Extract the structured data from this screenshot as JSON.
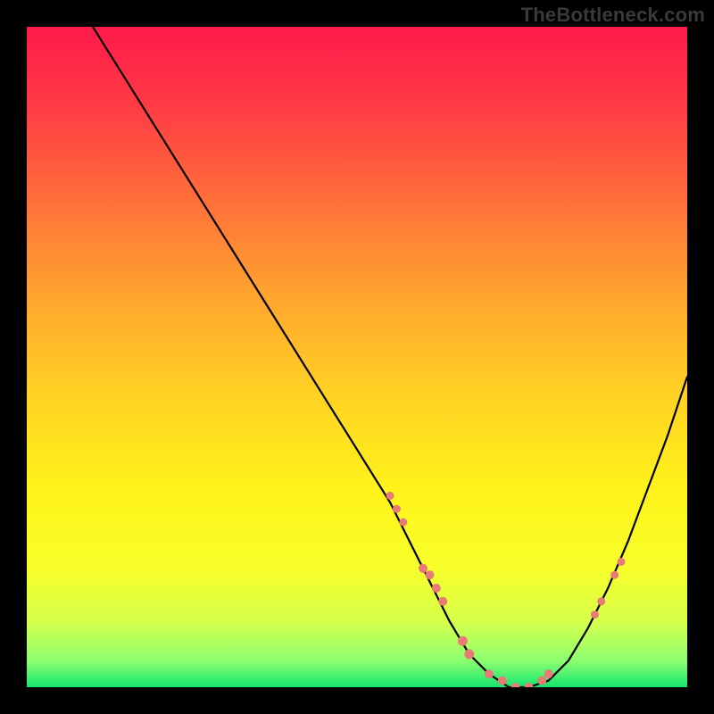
{
  "watermark": "TheBottleneck.com",
  "gradient": {
    "stops": [
      {
        "offset": 0.0,
        "color": "#ff1a4b"
      },
      {
        "offset": 0.12,
        "color": "#ff3b45"
      },
      {
        "offset": 0.25,
        "color": "#ff6a3a"
      },
      {
        "offset": 0.4,
        "color": "#ffa22f"
      },
      {
        "offset": 0.55,
        "color": "#ffd024"
      },
      {
        "offset": 0.7,
        "color": "#fff31a"
      },
      {
        "offset": 0.82,
        "color": "#f8ff2a"
      },
      {
        "offset": 0.9,
        "color": "#d6ff4a"
      },
      {
        "offset": 0.96,
        "color": "#8cff70"
      },
      {
        "offset": 1.0,
        "color": "#15e66f"
      }
    ]
  },
  "chart_data": {
    "type": "line",
    "title": "",
    "xlabel": "",
    "ylabel": "",
    "xlim": [
      0,
      100
    ],
    "ylim": [
      0,
      100
    ],
    "grid": false,
    "legend": false,
    "series": [
      {
        "name": "bottleneck-curve",
        "x": [
          10,
          15,
          20,
          25,
          30,
          35,
          40,
          45,
          50,
          55,
          58,
          61,
          64,
          67,
          70,
          73,
          76,
          79,
          82,
          85,
          88,
          91,
          94,
          97,
          100
        ],
        "y": [
          100,
          92,
          84,
          76,
          68,
          60,
          52,
          44,
          36,
          28,
          22,
          16,
          10,
          5,
          2,
          0,
          0,
          1,
          4,
          9,
          15,
          22,
          30,
          38,
          47
        ]
      }
    ],
    "markers": {
      "name": "highlight-points",
      "x": [
        55,
        56,
        57,
        60,
        61,
        62,
        63,
        66,
        67,
        70,
        72,
        74,
        76,
        78,
        79,
        86,
        87,
        89,
        90
      ],
      "y": [
        29,
        27,
        25,
        18,
        17,
        15,
        13,
        7,
        5,
        2,
        1,
        0,
        0,
        1,
        2,
        11,
        13,
        17,
        19
      ],
      "r": [
        4.5,
        4.5,
        4.5,
        5,
        5,
        5,
        5,
        5.5,
        5.5,
        5,
        5,
        5,
        5,
        5,
        5,
        4.5,
        4.5,
        4.5,
        4.5
      ]
    }
  }
}
